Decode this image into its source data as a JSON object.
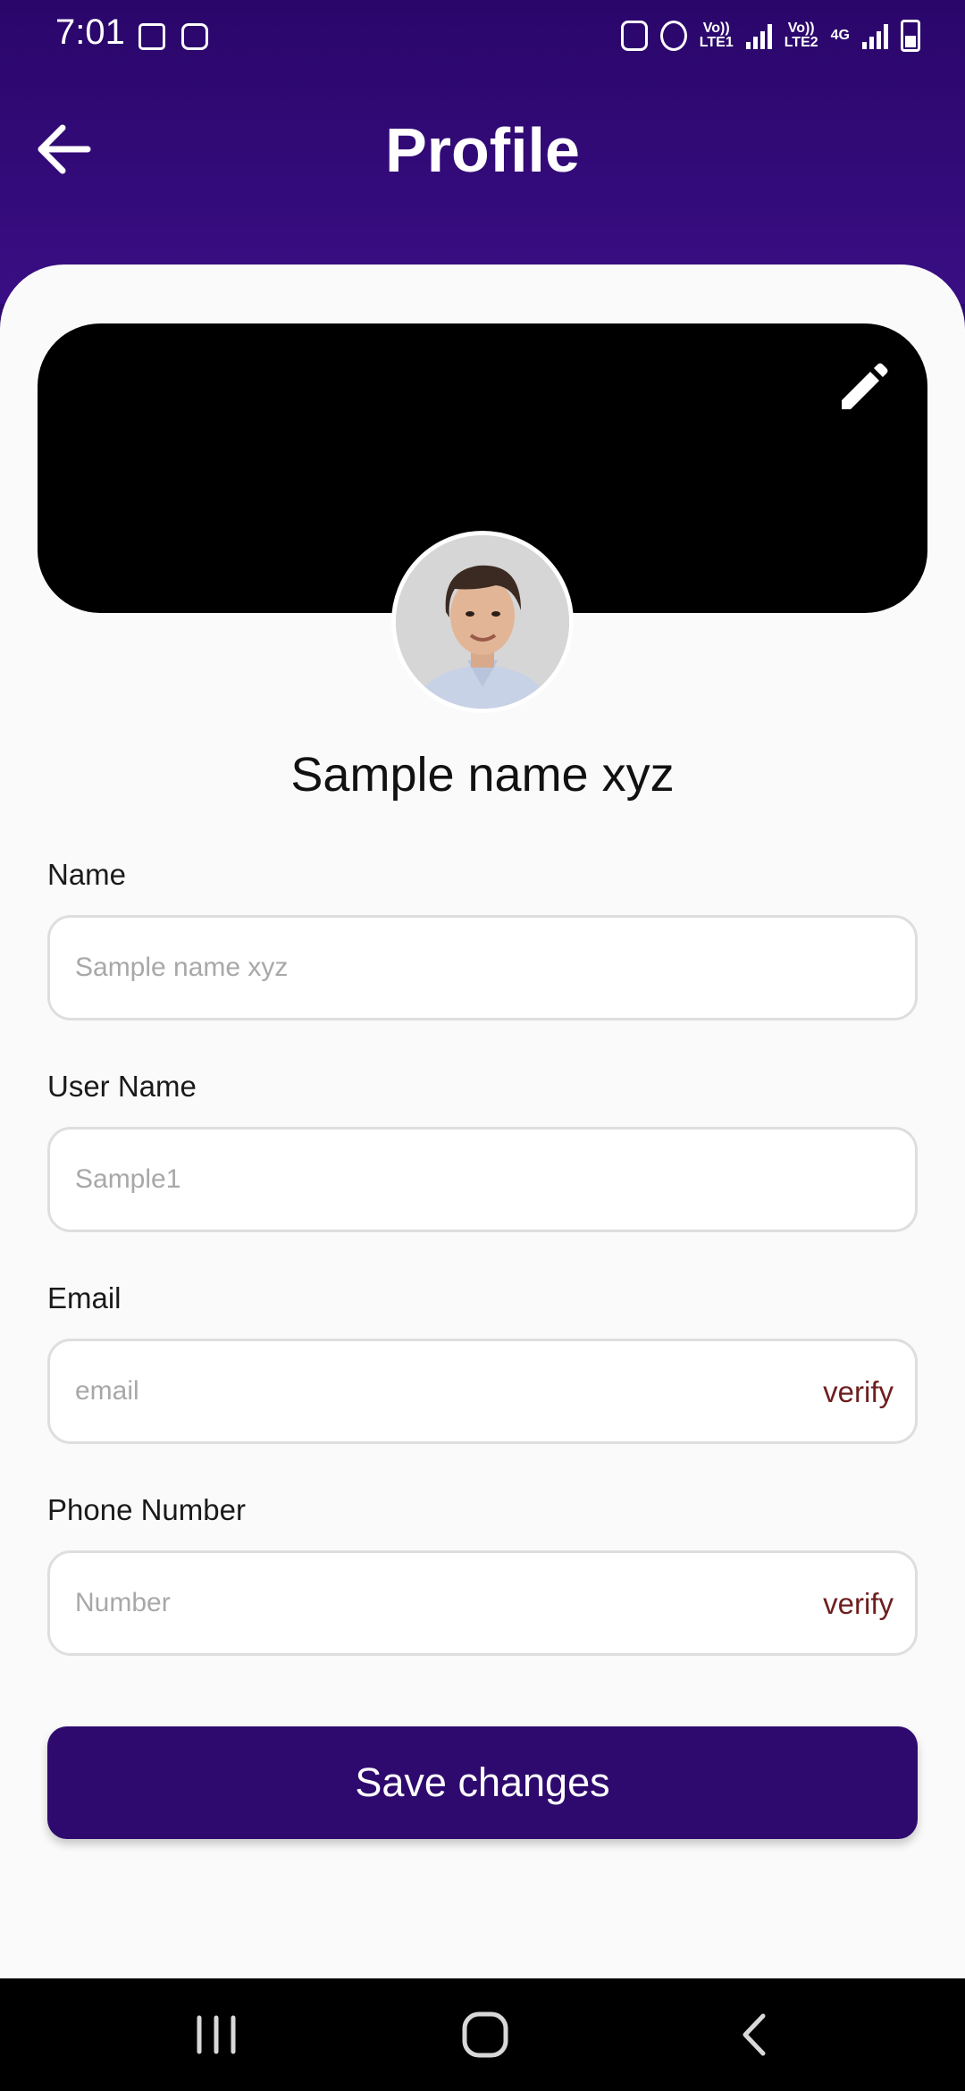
{
  "status_bar": {
    "time": "7:01",
    "sim1_label_top": "Vo))",
    "sim1_label_bottom": "LTE1",
    "sim2_label_top": "Vo))",
    "sim2_label_bottom": "LTE2",
    "network_type": "4G"
  },
  "header": {
    "title": "Profile",
    "back_icon": "arrow-left-icon"
  },
  "profile": {
    "display_name": "Sample name xyz",
    "edit_icon": "pencil-icon"
  },
  "form": {
    "name_label": "Name",
    "name_placeholder": "Sample name xyz",
    "username_label": "User Name",
    "username_placeholder": "Sample1",
    "email_label": "Email",
    "email_placeholder": "email",
    "email_verify": "verify",
    "phone_label": "Phone Number",
    "phone_placeholder": "Number",
    "phone_verify": "verify"
  },
  "actions": {
    "save_label": "Save changes"
  },
  "colors": {
    "primary": "#2e0a6e",
    "verify_text": "#6e1e1e",
    "card_background": "#fafafa"
  }
}
